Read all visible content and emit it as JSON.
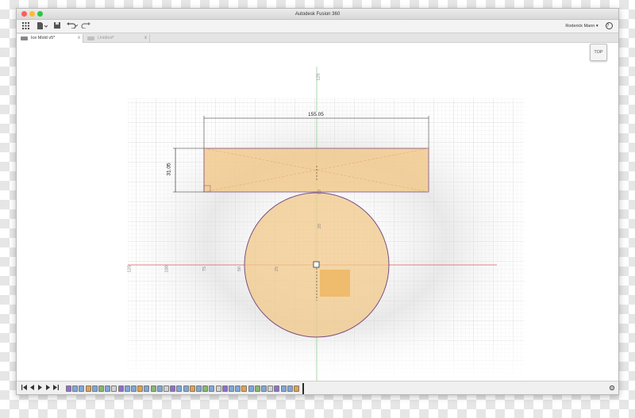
{
  "app": {
    "title": "Autodesk Fusion 360"
  },
  "toolbar": {
    "grid_icon": "grid-icon",
    "file_icon": "file-icon",
    "save_icon": "save-icon",
    "undo_icon": "undo-icon",
    "redo_icon": "redo-icon",
    "user_name": "Roderick Mann ▾",
    "help_label": "?"
  },
  "tabs": [
    {
      "label": "Ice Mold v5*",
      "close": "x",
      "active": true
    },
    {
      "label": "Untitled*",
      "close": "x",
      "active": false
    }
  ],
  "viewcube": {
    "label": "TOP"
  },
  "sketch": {
    "width_dimension": "155.05",
    "height_dimension": "31.05",
    "ruler_top": "125",
    "ruler_left_far": "125",
    "ruler_100": "100",
    "ruler_75": "75",
    "ruler_50": "50",
    "ruler_25": "25",
    "ruler_vert_25": "25",
    "ruler_vert_50": "50"
  },
  "colors": {
    "fill": "#f2c88a",
    "fill_stroke": "#7a4f7f",
    "axis_red": "#e05a5a",
    "axis_green": "#6ac26a",
    "grid": "#cfcfcf"
  },
  "timeline": {
    "nav_icons": [
      "skip-start-icon",
      "step-back-icon",
      "play-icon",
      "step-forward-icon",
      "skip-end-icon"
    ],
    "settings_icon": "gear-icon"
  }
}
